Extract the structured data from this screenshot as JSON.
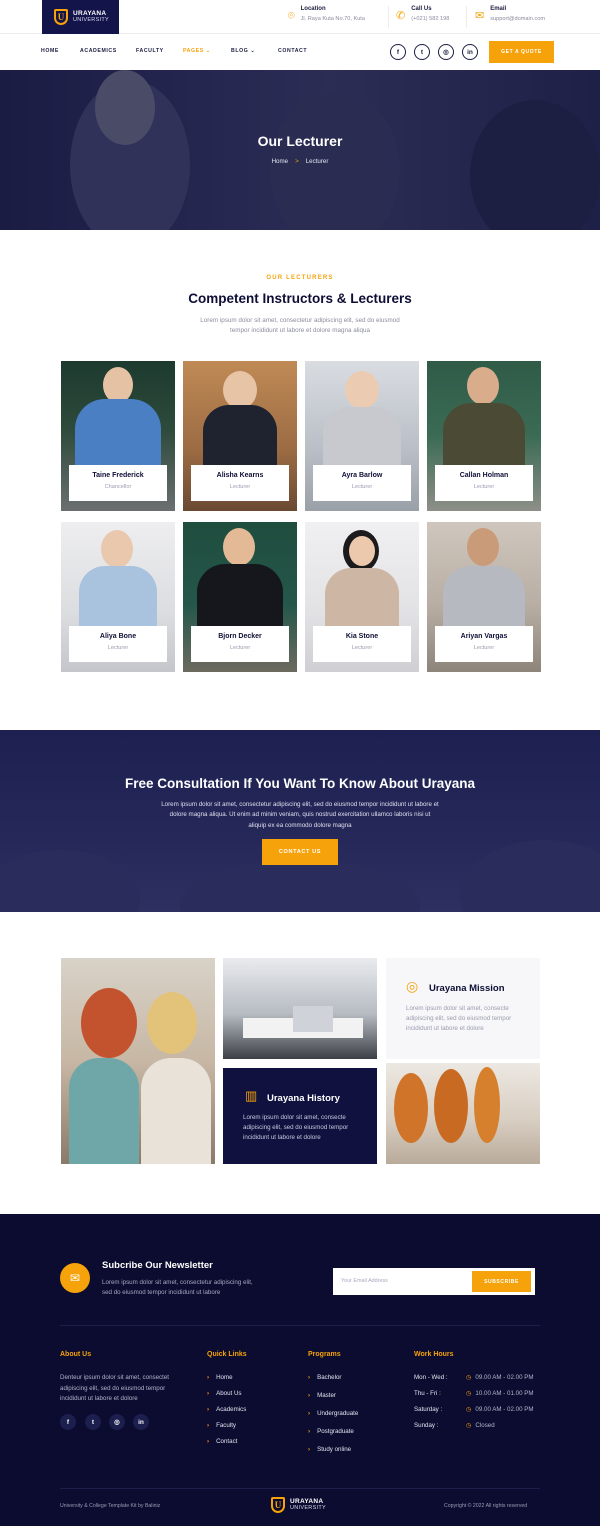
{
  "brand": {
    "name": "URAYANA",
    "sub": "UNIVERSITY",
    "mark": "U"
  },
  "contact": {
    "location_label": "Location",
    "location_value": "Jl. Raya Kuta No.70, Kuta",
    "call_label": "Call Us",
    "call_value": "(+021) 582 198",
    "email_label": "Email",
    "email_value": "support@domain.com"
  },
  "nav": {
    "home": "HOME",
    "academics": "ACADEMICS",
    "faculty": "FACULTY",
    "pages": "PAGES",
    "blog": "BLOG",
    "contact": "CONTACT",
    "active": "PAGES"
  },
  "social": {
    "facebook": "f",
    "twitter": "t",
    "instagram": "◎",
    "linkedin": "in"
  },
  "quote_button": "GET A QUOTE",
  "hero": {
    "title": "Our Lecturer",
    "crumb_home": "Home",
    "crumb_sep": ">",
    "crumb_current": "Lecturer"
  },
  "lecturers": {
    "eyebrow": "OUR LECTURERS",
    "title": "Competent Instructors & Lecturers",
    "text": "Lorem ipsum dolor sit amet, consectetur adipiscing elit, sed do eiusmod tempor incididunt ut labore et dolore magna aliqua",
    "people": [
      {
        "name": "Taine Frederick",
        "role": "Chancellor"
      },
      {
        "name": "Alisha Kearns",
        "role": "Lecturer"
      },
      {
        "name": "Ayra Barlow",
        "role": "Lecturer"
      },
      {
        "name": "Callan Holman",
        "role": "Lecturer"
      },
      {
        "name": "Aliya Bone",
        "role": "Lecturer"
      },
      {
        "name": "Bjorn Decker",
        "role": "Lecturer"
      },
      {
        "name": "Kia Stone",
        "role": "Lecturer"
      },
      {
        "name": "Ariyan Vargas",
        "role": "Lecturer"
      }
    ]
  },
  "consultation": {
    "title": "Free Consultation If You Want To Know About Urayana",
    "text": "Lorem ipsum dolor sit amet, consectetur adipiscing elit, sed do eiusmod tempor incididunt ut labore et dolore magna aliqua. Ut enim ad minim veniam, quis nostrud exercitation ullamco laboris nisi ut aliquip ex ea commodo dolore magna",
    "button": "CONTACT US"
  },
  "mission": {
    "title": "Urayana Mission",
    "text": "Lorem ipsum dolor sit amet, consecte adipiscing elit, sed do eiusmod tempor incididunt ut labore et dolore"
  },
  "history": {
    "title": "Urayana History",
    "text": "Lorem ipsum dolor sit amet, consecte adipiscing elit, sed do eiusmod tempor incididunt ut labore et dolore"
  },
  "newsletter": {
    "title": "Subcribe Our Newsletter",
    "text": "Lorem ipsum dolor sit amet, consectetur adipiscing elit, sed do eiusmod tempor incididunt ut labore",
    "placeholder": "Your Email Address",
    "button": "SUBSCRIBE"
  },
  "footer": {
    "about_head": "About Us",
    "about_text": "Denteur ipsum dolor sit amet, consectet adipiscing elit, sed do eiusmod tempor incididunt ut labore et dolore",
    "quick_head": "Quick Links",
    "quick": [
      "Home",
      "About Us",
      "Academics",
      "Faculty",
      "Contact"
    ],
    "programs_head": "Programs",
    "programs": [
      "Bachelor",
      "Master",
      "Undergraduate",
      "Postgraduate",
      "Study online"
    ],
    "hours_head": "Work Hours",
    "hours": [
      {
        "day": "Mon - Wed :",
        "time": "09.00 AM - 02.00 PM"
      },
      {
        "day": "Thu - Fri :",
        "time": "10.00 AM - 01.00 PM"
      },
      {
        "day": "Saturday :",
        "time": "09.00 AM - 02.00 PM"
      },
      {
        "day": "Sunday :",
        "time": "Closed"
      }
    ],
    "credit": "University & College Template Kit by Baliniz",
    "copyright": "Copyright © 2022 All rights reserved"
  }
}
